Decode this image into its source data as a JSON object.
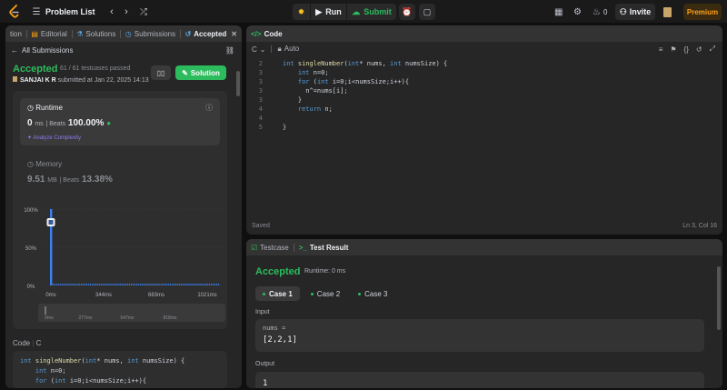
{
  "topbar": {
    "problem_list": "Problem List",
    "run": "Run",
    "submit": "Submit",
    "streak": "0",
    "invite": "Invite",
    "premium": "Premium"
  },
  "left_tabs": [
    {
      "label": "tion",
      "icon": ""
    },
    {
      "label": "Editorial",
      "icon": "book-icon"
    },
    {
      "label": "Solutions",
      "icon": "flask-icon"
    },
    {
      "label": "Submissions",
      "icon": "clock-icon"
    },
    {
      "label": "Accepted",
      "icon": "history-icon"
    }
  ],
  "submission": {
    "back_label": "All Submissions",
    "status": "Accepted",
    "testcases": "61 / 61 testcases passed",
    "user": "SANJAI K R",
    "submitted_at": "submitted at Jan 22, 2025 14:13",
    "solution_btn": "Solution",
    "runtime_label": "Runtime",
    "runtime_value": "0",
    "runtime_unit": "ms",
    "beats_label": "Beats",
    "beats_value": "100.00%",
    "analyze": "Analyze Complexity",
    "memory_label": "Memory",
    "memory_value": "9.51",
    "memory_unit": "MB",
    "memory_beats_label": "Beats",
    "memory_beats_value": "13.38%",
    "code_label": "Code",
    "code_lang": "C",
    "code_lines": [
      "int singleNumber(int* nums, int numsSize) {",
      "    int n=0;",
      "    for (int i=0;i<numsSize;i++){"
    ]
  },
  "chart_data": {
    "type": "bar",
    "ylabels": [
      "100%",
      "50%",
      "0%"
    ],
    "xlabels": [
      "0ms",
      "344ms",
      "683ms",
      "1021ms"
    ],
    "scrub_labels": [
      "0ms",
      "277ms",
      "547ms",
      "818ms"
    ],
    "highlight_value": 100
  },
  "editor": {
    "title": "Code",
    "lang": "C",
    "mode": "Auto",
    "lines": [
      "int singleNumber(int* nums, int numsSize) {",
      "    int n=0;",
      "    for (int i=0;i<numsSize;i++){",
      "      n^=nums[i];",
      "    }",
      "    return n;",
      "",
      "}"
    ],
    "line_numbers": [
      "2",
      "3",
      "3",
      "3",
      "3",
      "4",
      "4",
      "5"
    ],
    "saved": "Saved",
    "cursor": "Ln 3, Col 16"
  },
  "result": {
    "tab_testcase": "Testcase",
    "tab_result": "Test Result",
    "status": "Accepted",
    "runtime": "Runtime: 0 ms",
    "cases": [
      "Case 1",
      "Case 2",
      "Case 3"
    ],
    "input_label": "Input",
    "input_var": "nums =",
    "input_value": "[2,2,1]",
    "output_label": "Output",
    "output_value": "1"
  },
  "colors": {
    "accent_green": "#2cbb5d",
    "premium": "#ffa116",
    "bar_blue": "#3b82f6"
  }
}
